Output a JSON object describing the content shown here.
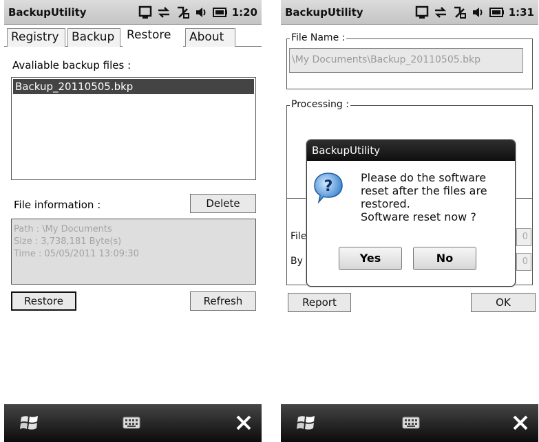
{
  "screen1": {
    "app_title": "BackupUtility",
    "clock": "1:20",
    "tabs": [
      "Registry",
      "Backup",
      "Restore",
      "About"
    ],
    "active_tab": "Restore",
    "available_label": "Avaliable backup files :",
    "files": [
      "Backup_20110505.bkp"
    ],
    "file_info_label": "File information :",
    "delete_button": "Delete",
    "info": {
      "path": "Path : \\My Documents",
      "size": "Size : 3,738,181 Byte(s)",
      "time": "Time : 05/05/2011 13:09:30"
    },
    "restore_button": "Restore",
    "refresh_button": "Refresh"
  },
  "screen2": {
    "app_title": "BackupUtility",
    "clock": "1:31",
    "file_name_legend": "File Name :",
    "file_path": "\\My Documents\\Backup_20110505.bkp",
    "processing_legend": "Processing :",
    "partial_label_1": "File",
    "partial_label_2": "By",
    "partial_value_1": "0",
    "partial_value_2": "0",
    "report_button": "Report",
    "ok_button": "OK",
    "dialog": {
      "title": "BackupUtility",
      "line1": "Please do the software",
      "line2": "reset after the files are",
      "line3": "restored.",
      "line4": "Software reset now ?",
      "yes": "Yes",
      "no": "No"
    }
  },
  "icons": [
    "windows-start-icon",
    "keyboard-icon",
    "close-icon",
    "signal-icon",
    "sync-icon",
    "connection-icon",
    "speaker-icon",
    "battery-icon",
    "question-icon"
  ],
  "colors": {
    "titlebar": "#c8c8c8",
    "selection": "#444444",
    "taskbar": "#1a1a1a",
    "dialog_title": "#1a1a1a"
  }
}
